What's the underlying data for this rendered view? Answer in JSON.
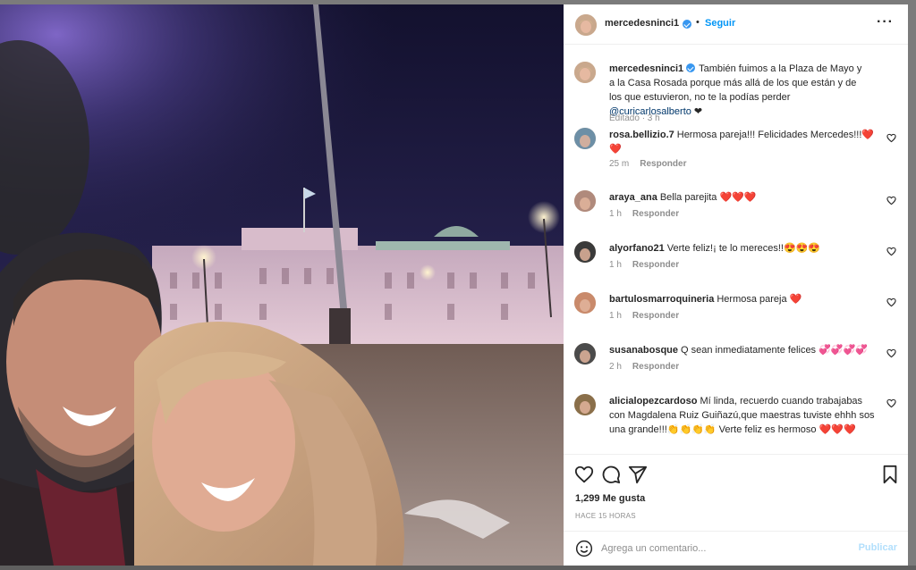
{
  "post": {
    "username": "mercedesninci1",
    "follow_label": "Seguir",
    "more_icon": "more-dots-icon",
    "caption": {
      "username": "mercedesninci1",
      "text": "También fuimos a la Plaza de Mayo y a la Casa Rosada porque más allá de los que están y de los que estuvieron, no te la podías perder ",
      "mention": "@curicarlosalberto",
      "suffix": " ❤",
      "meta": "Editado · 3 h"
    },
    "reply_label": "Responder",
    "comments": [
      {
        "username": "rosa.bellizio.7",
        "text": "Hermosa pareja!!! Felicidades Mercedes!!!❤️❤️",
        "time": "25 m",
        "avatar_color": "#6d8fa6"
      },
      {
        "username": "araya_ana",
        "text": "Bella parejita ❤️❤️❤️",
        "time": "1 h",
        "avatar_color": "#b08a7c"
      },
      {
        "username": "alyorfano21",
        "text": "Verte feliz!¡ te lo mereces!!😍😍😍",
        "time": "1 h",
        "avatar_color": "#3a3a3a"
      },
      {
        "username": "bartulosmarroquineria",
        "text": "Hermosa pareja ❤️",
        "time": "1 h",
        "avatar_color": "#c98a6b"
      },
      {
        "username": "susanabosque",
        "text": "Q sean inmediatamente felices 💞💞💞💞",
        "time": "2 h",
        "avatar_color": "#4b4b4b"
      },
      {
        "username": "alicialopezcardoso",
        "text": "Mí linda, recuerdo cuando trabajabas con Magdalena Ruiz Guiñazú,que maestras tuviste ehhh sos una grande!!!👏👏👏👏 Verte feliz es hermoso ❤️❤️❤️",
        "time": "",
        "avatar_color": "#8a6f4a"
      }
    ],
    "likes": "1,299 Me gusta",
    "time_ago": "HACE 15 HORAS",
    "comment_placeholder": "Agrega un comentario...",
    "publish_label": "Publicar",
    "icons": {
      "like": "heart-icon",
      "comment": "comment-icon",
      "share": "share-icon",
      "save": "bookmark-icon",
      "emoji": "emoji-icon"
    },
    "colors": {
      "link": "#0095f6",
      "publish_disabled": "#b2dffc",
      "verified": "#3897f0"
    }
  }
}
